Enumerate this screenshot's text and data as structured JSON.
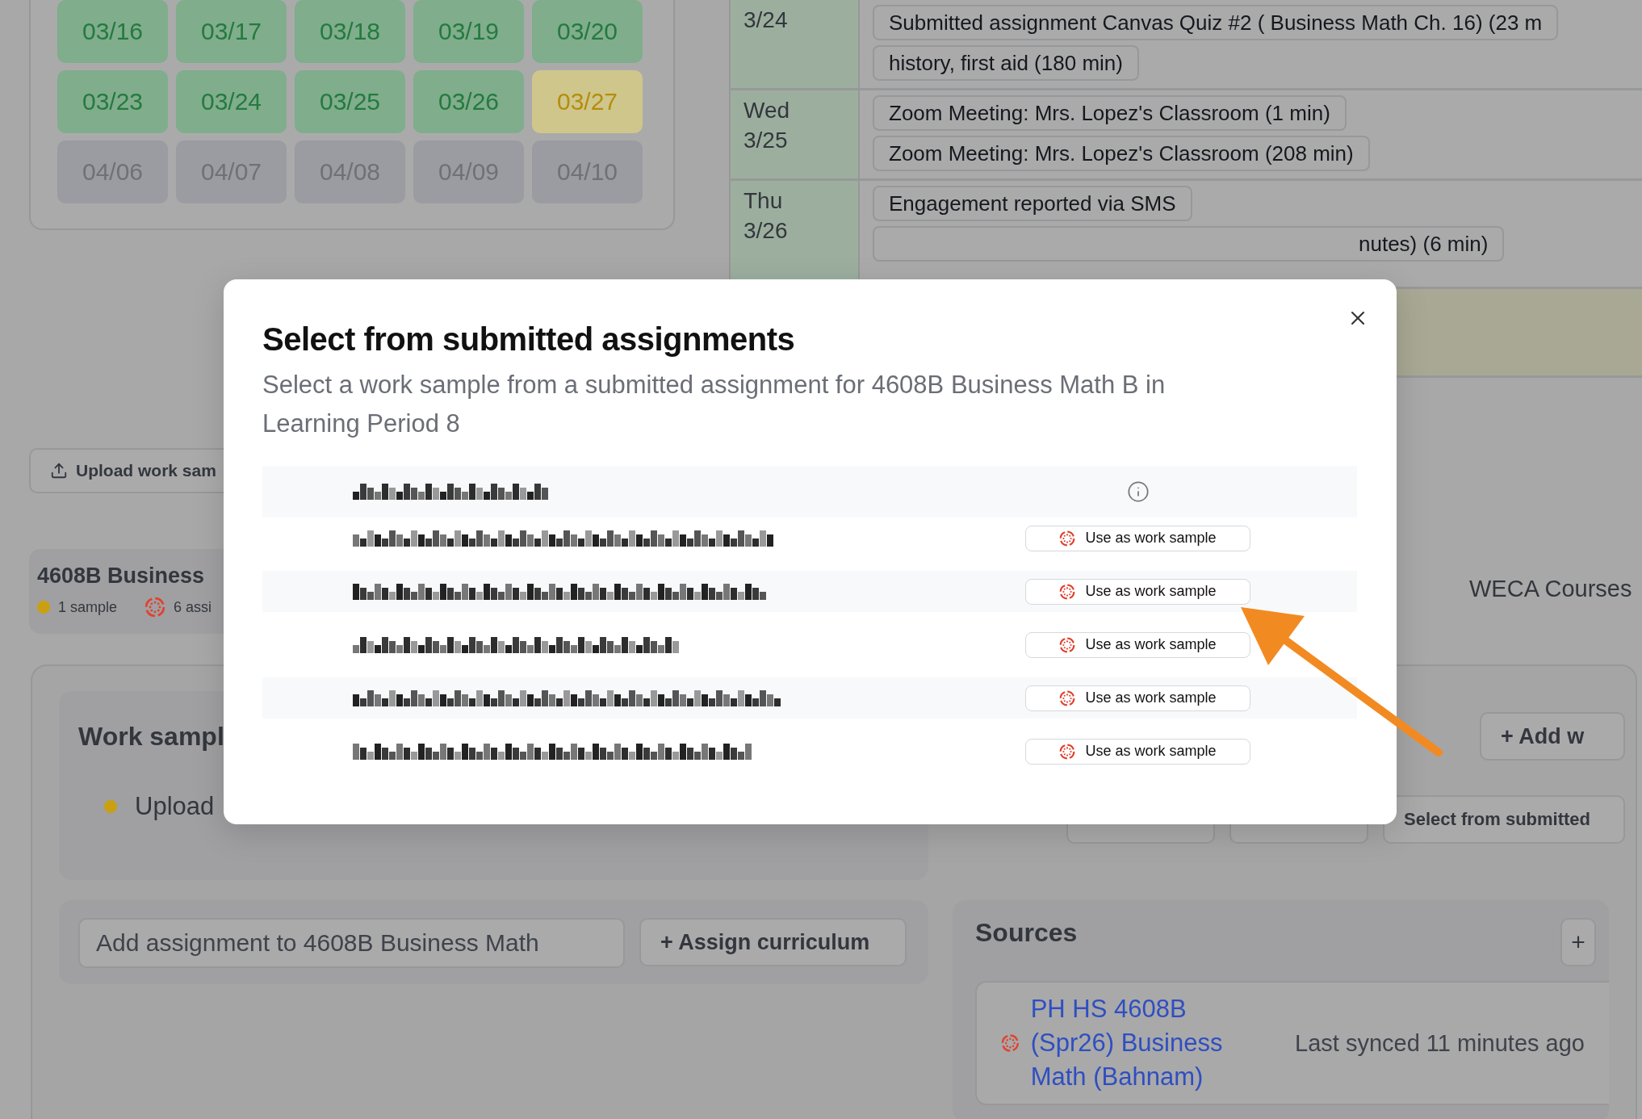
{
  "calendar": {
    "weeks": [
      [
        {
          "date": "03/16",
          "color": "#80ad8c"
        },
        {
          "date": "03/17",
          "color": "#80ad8c"
        },
        {
          "date": "03/18",
          "color": "#80ad8c"
        },
        {
          "date": "03/19",
          "color": "#80ad8c"
        },
        {
          "date": "03/20",
          "color": "#80ad8c"
        }
      ],
      [
        {
          "date": "03/23",
          "color": "#80ad8c"
        },
        {
          "date": "03/24",
          "color": "#80ad8c"
        },
        {
          "date": "03/25",
          "color": "#80ad8c"
        },
        {
          "date": "03/26",
          "color": "#80ad8c"
        },
        {
          "date": "03/27",
          "color": "#cfc68c"
        }
      ],
      [
        {
          "date": "04/06",
          "color": "#9b9ca1"
        },
        {
          "date": "04/07",
          "color": "#9b9ca1"
        },
        {
          "date": "04/08",
          "color": "#9b9ca1"
        },
        {
          "date": "04/09",
          "color": "#9b9ca1"
        },
        {
          "date": "04/10",
          "color": "#9b9ca1"
        }
      ]
    ]
  },
  "timeline": {
    "days": [
      {
        "date": "3/24",
        "color": "#9caf9f",
        "entries": [
          {
            "text": "Submitted assignment Canvas Quiz #2 ( Business Math Ch. 16) (23 m",
            "kind": "full"
          },
          {
            "text": "history, first aid (180 min)",
            "kind": "full"
          }
        ]
      },
      {
        "weekday": "Wed",
        "date": "3/25",
        "color": "#9caf9f",
        "entries": [
          {
            "text": "Zoom Meeting: Mrs. Lopez's Classroom (1 min)",
            "kind": "full"
          },
          {
            "text": "Zoom Meeting: Mrs. Lopez's Classroom (208 min)",
            "kind": "full"
          }
        ]
      },
      {
        "weekday": "Thu",
        "date": "3/26",
        "color": "#9caf9f",
        "entries": [
          {
            "text": "Engagement reported via SMS",
            "kind": "full"
          },
          {
            "text": "nutes) (6 min)",
            "kind": "covered"
          }
        ]
      },
      {
        "color": "#a9a894"
      }
    ]
  },
  "upload_button": {
    "label": "Upload work sam"
  },
  "course_card": {
    "title": "4608B Business",
    "samples": "1 sample",
    "assignments": "6 assi"
  },
  "weca_label": "WECA Courses",
  "work_samples": {
    "title": "Work sampl",
    "items": [
      {
        "text": "Upload"
      }
    ],
    "add_button": "+ Add w",
    "select_button": "Select from submitted"
  },
  "assignment": {
    "placeholder": "Add assignment to 4608B Business Math",
    "assign_button": "+ Assign curriculum"
  },
  "sources": {
    "title": "Sources",
    "add_button": "+",
    "items": [
      {
        "name": "PH HS 4608B (Spr26) Business Math (Bahnam)",
        "synced": "Last synced 11 minutes ago"
      }
    ]
  },
  "modal": {
    "title": "Select from submitted assignments",
    "subtitle": "Select a work sample from a submitted assignment for 4608B Business Math B in Learning Period 8",
    "header": {
      "kind": "redacted"
    },
    "rows": [
      {
        "kind": "redacted",
        "action": "Use as work sample"
      },
      {
        "kind": "redacted",
        "action": "Use as work sample"
      },
      {
        "kind": "redacted",
        "action": "Use as work sample"
      },
      {
        "kind": "redacted",
        "action": "Use as work sample"
      },
      {
        "kind": "redacted",
        "action": "Use as work sample"
      }
    ]
  }
}
